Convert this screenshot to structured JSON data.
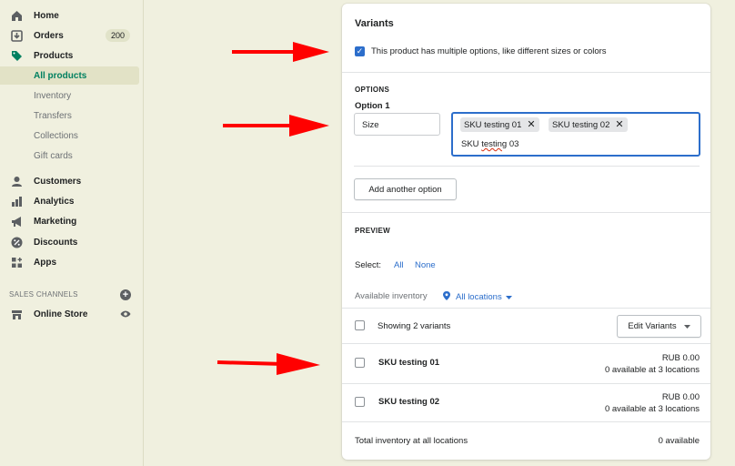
{
  "sidebar": {
    "items": [
      {
        "label": "Home",
        "icon": "home-icon"
      },
      {
        "label": "Orders",
        "icon": "orders-icon",
        "badge": "200"
      },
      {
        "label": "Products",
        "icon": "tag-icon"
      }
    ],
    "product_sub": [
      "All products",
      "Inventory",
      "Transfers",
      "Collections",
      "Gift cards"
    ],
    "items2": [
      {
        "label": "Customers",
        "icon": "person-icon"
      },
      {
        "label": "Analytics",
        "icon": "bar-chart-icon"
      },
      {
        "label": "Marketing",
        "icon": "megaphone-icon"
      },
      {
        "label": "Discounts",
        "icon": "discount-icon"
      },
      {
        "label": "Apps",
        "icon": "apps-icon"
      }
    ],
    "sales_channels_label": "SALES CHANNELS",
    "online_store": "Online Store"
  },
  "variants": {
    "title": "Variants",
    "multiple_options_label": "This product has multiple options, like different sizes or colors",
    "options_caption": "OPTIONS",
    "option1_label": "Option 1",
    "option1_name": "Size",
    "tags": [
      "SKU testing 01",
      "SKU testing 02"
    ],
    "typing_value_a": "SKU ",
    "typing_value_b": "testing",
    "typing_value_c": " 03",
    "add_option_button": "Add another option"
  },
  "preview": {
    "caption": "PREVIEW",
    "select_label": "Select:",
    "select_all": "All",
    "select_none": "None",
    "available_inventory": "Available inventory",
    "locations_link": "All locations",
    "showing": "Showing 2 variants",
    "edit_variants": "Edit Variants",
    "rows": [
      {
        "name": "SKU testing 01",
        "price": "RUB 0.00",
        "availability": "0 available at 3 locations"
      },
      {
        "name": "SKU testing 02",
        "price": "RUB 0.00",
        "availability": "0 available at 3 locations"
      }
    ],
    "total_label": "Total inventory at all locations",
    "total_value": "0 available"
  },
  "colors": {
    "accent": "#2c6ecb",
    "brand_green": "#008060",
    "annotation_red": "#ff0000"
  }
}
